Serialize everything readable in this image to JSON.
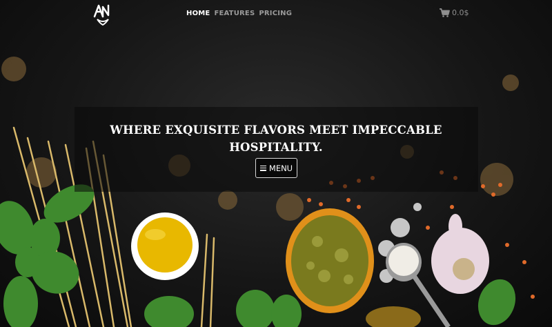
{
  "nav": {
    "links": [
      {
        "label": "HOME",
        "active": true
      },
      {
        "label": "FEATURES",
        "active": false
      },
      {
        "label": "PRICING",
        "active": false
      }
    ],
    "cart_total": "0.0$",
    "cart_icon": "shopping-cart-icon",
    "logo_icon": "restaurant-logo-icon"
  },
  "hero": {
    "title": "WHERE EXQUISITE FLAVORS MEET IMPECCABLE HOSPITALITY.",
    "menu_button_label": "MENU",
    "menu_icon": "hamburger-menu-icon"
  },
  "colors": {
    "background": "#141414",
    "nav_active": "#ffffff",
    "nav_inactive": "#9a9a9a",
    "olive_oil": "#e8b800",
    "pesto": "#7a7a1e",
    "basil": "#3f8a2e",
    "bowl_orange": "#e0901a"
  }
}
